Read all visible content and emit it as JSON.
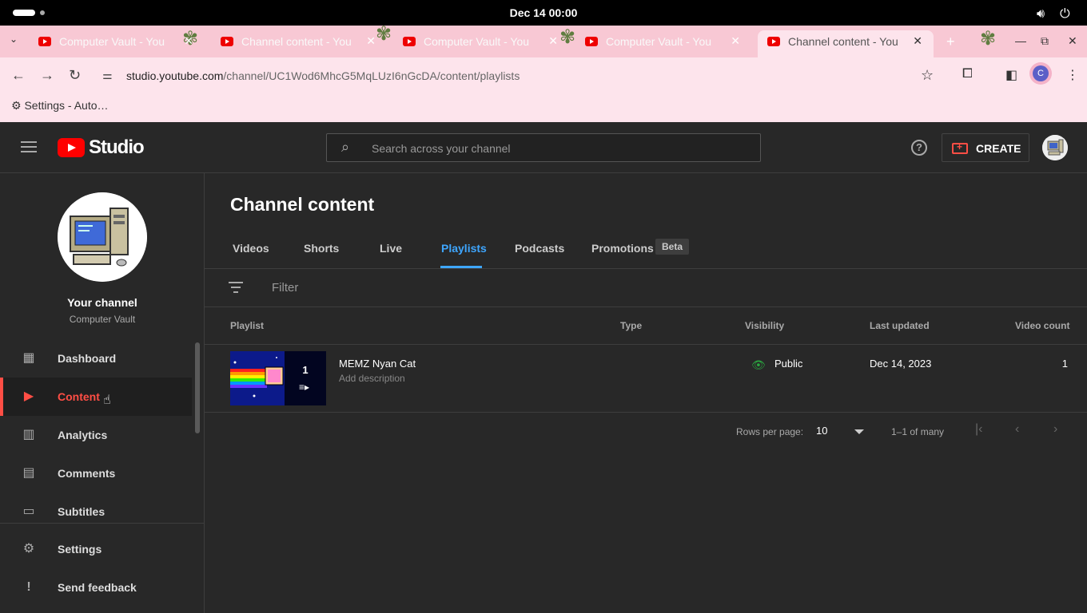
{
  "system": {
    "clock": "Dec 14  00:00",
    "volume_icon": "volume-icon",
    "power_icon": "power-icon"
  },
  "browser": {
    "tabs": [
      {
        "title": "Computer Vault - You",
        "active": false
      },
      {
        "title": "Channel content - You",
        "active": false
      },
      {
        "title": "Computer Vault - You",
        "active": false
      },
      {
        "title": "Computer Vault - You",
        "active": false
      },
      {
        "title": "Channel content - You",
        "active": true
      }
    ],
    "url_domain": "studio.youtube.com",
    "url_path": "/channel/UC1Wod6MhcG5MqLUzI6nGcDA/content/playlists",
    "bookmark": "Settings - Auto…",
    "profile_initial": "C"
  },
  "header": {
    "logo_text": "Studio",
    "search_placeholder": "Search across your channel",
    "help": "?",
    "create_label": "CREATE"
  },
  "sidebar": {
    "channel_title": "Your channel",
    "channel_name": "Computer Vault",
    "items": [
      {
        "label": "Dashboard",
        "icon": "dashboard-icon",
        "glyph": "▦"
      },
      {
        "label": "Content",
        "icon": "content-icon",
        "glyph": "▶"
      },
      {
        "label": "Analytics",
        "icon": "analytics-icon",
        "glyph": "▥"
      },
      {
        "label": "Comments",
        "icon": "comments-icon",
        "glyph": "▤"
      },
      {
        "label": "Subtitles",
        "icon": "subtitles-icon",
        "glyph": "▭"
      },
      {
        "label": "Settings",
        "icon": "settings-icon",
        "glyph": "⚙"
      },
      {
        "label": "Send feedback",
        "icon": "feedback-icon",
        "glyph": "!"
      }
    ]
  },
  "main": {
    "title": "Channel content",
    "tabs": [
      "Videos",
      "Shorts",
      "Live",
      "Playlists",
      "Podcasts",
      "Promotions"
    ],
    "active_tab": "Playlists",
    "beta_badge": "Beta",
    "filter_placeholder": "Filter",
    "columns": [
      "Playlist",
      "Type",
      "Visibility",
      "Last updated",
      "Video count"
    ],
    "rows": [
      {
        "title": "MEMZ Nyan Cat",
        "description": "Add description",
        "type": "",
        "visibility": "Public",
        "last_updated": "Dec 14, 2023",
        "video_count": "1",
        "thumb_count": "1"
      }
    ],
    "pagination": {
      "rows_per_page_label": "Rows per page:",
      "rows_per_page": "10",
      "range": "1–1 of many"
    }
  }
}
